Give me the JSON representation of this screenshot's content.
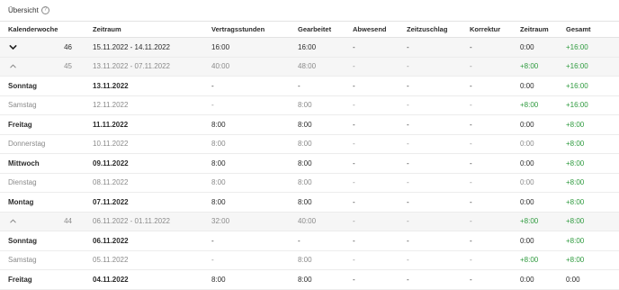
{
  "header": {
    "title": "Übersicht",
    "info_icon": "info-icon"
  },
  "columns": [
    "Kalenderwoche",
    "Zeitraum",
    "Vertragsstunden",
    "Gearbeitet",
    "Abwesend",
    "Zeitzuschlag",
    "Korrektur",
    "Zeitraum",
    "Gesamt"
  ],
  "rows": [
    {
      "kind": "week",
      "expanded": false,
      "chevron": "chevron-down-icon",
      "kw": "46",
      "period": "15.11.2022 - 14.11.2022",
      "contract": "16:00",
      "worked": "16:00",
      "absent": "-",
      "surcharge": "-",
      "correction": "-",
      "range": "0:00",
      "total": "+16:00",
      "muted": false
    },
    {
      "kind": "week",
      "expanded": true,
      "chevron": "chevron-up-icon",
      "kw": "45",
      "period": "13.11.2022 - 07.11.2022",
      "contract": "40:00",
      "worked": "48:00",
      "absent": "-",
      "surcharge": "-",
      "correction": "-",
      "range": "+8:00",
      "total": "+16:00",
      "muted": true
    },
    {
      "kind": "day",
      "label": "Sonntag",
      "period": "13.11.2022",
      "contract": "-",
      "worked": "-",
      "absent": "-",
      "surcharge": "-",
      "correction": "-",
      "range": "0:00",
      "total": "+16:00",
      "muted": false
    },
    {
      "kind": "day",
      "label": "Samstag",
      "period": "12.11.2022",
      "contract": "-",
      "worked": "8:00",
      "absent": "-",
      "surcharge": "-",
      "correction": "-",
      "range": "+8:00",
      "total": "+16:00",
      "muted": true
    },
    {
      "kind": "day",
      "label": "Freitag",
      "period": "11.11.2022",
      "contract": "8:00",
      "worked": "8:00",
      "absent": "-",
      "surcharge": "-",
      "correction": "-",
      "range": "0:00",
      "total": "+8:00",
      "muted": false
    },
    {
      "kind": "day",
      "label": "Donnerstag",
      "period": "10.11.2022",
      "contract": "8:00",
      "worked": "8:00",
      "absent": "-",
      "surcharge": "-",
      "correction": "-",
      "range": "0:00",
      "total": "+8:00",
      "muted": true
    },
    {
      "kind": "day",
      "label": "Mittwoch",
      "period": "09.11.2022",
      "contract": "8:00",
      "worked": "8:00",
      "absent": "-",
      "surcharge": "-",
      "correction": "-",
      "range": "0:00",
      "total": "+8:00",
      "muted": false
    },
    {
      "kind": "day",
      "label": "Dienstag",
      "period": "08.11.2022",
      "contract": "8:00",
      "worked": "8:00",
      "absent": "-",
      "surcharge": "-",
      "correction": "-",
      "range": "0:00",
      "total": "+8:00",
      "muted": true
    },
    {
      "kind": "day",
      "label": "Montag",
      "period": "07.11.2022",
      "contract": "8:00",
      "worked": "8:00",
      "absent": "-",
      "surcharge": "-",
      "correction": "-",
      "range": "0:00",
      "total": "+8:00",
      "muted": false
    },
    {
      "kind": "week",
      "expanded": true,
      "chevron": "chevron-up-icon",
      "kw": "44",
      "period": "06.11.2022 - 01.11.2022",
      "contract": "32:00",
      "worked": "40:00",
      "absent": "-",
      "surcharge": "-",
      "correction": "-",
      "range": "+8:00",
      "total": "+8:00",
      "muted": true
    },
    {
      "kind": "day",
      "label": "Sonntag",
      "period": "06.11.2022",
      "contract": "-",
      "worked": "-",
      "absent": "-",
      "surcharge": "-",
      "correction": "-",
      "range": "0:00",
      "total": "+8:00",
      "muted": false
    },
    {
      "kind": "day",
      "label": "Samstag",
      "period": "05.11.2022",
      "contract": "-",
      "worked": "8:00",
      "absent": "-",
      "surcharge": "-",
      "correction": "-",
      "range": "+8:00",
      "total": "+8:00",
      "muted": true
    },
    {
      "kind": "day",
      "label": "Freitag",
      "period": "04.11.2022",
      "contract": "8:00",
      "worked": "8:00",
      "absent": "-",
      "surcharge": "-",
      "correction": "-",
      "range": "0:00",
      "total": "0:00",
      "muted": false
    }
  ],
  "colors": {
    "positive": "#2e9a3e",
    "muted_text": "#8a8a8a",
    "week_row_bg": "#f6f6f6"
  }
}
